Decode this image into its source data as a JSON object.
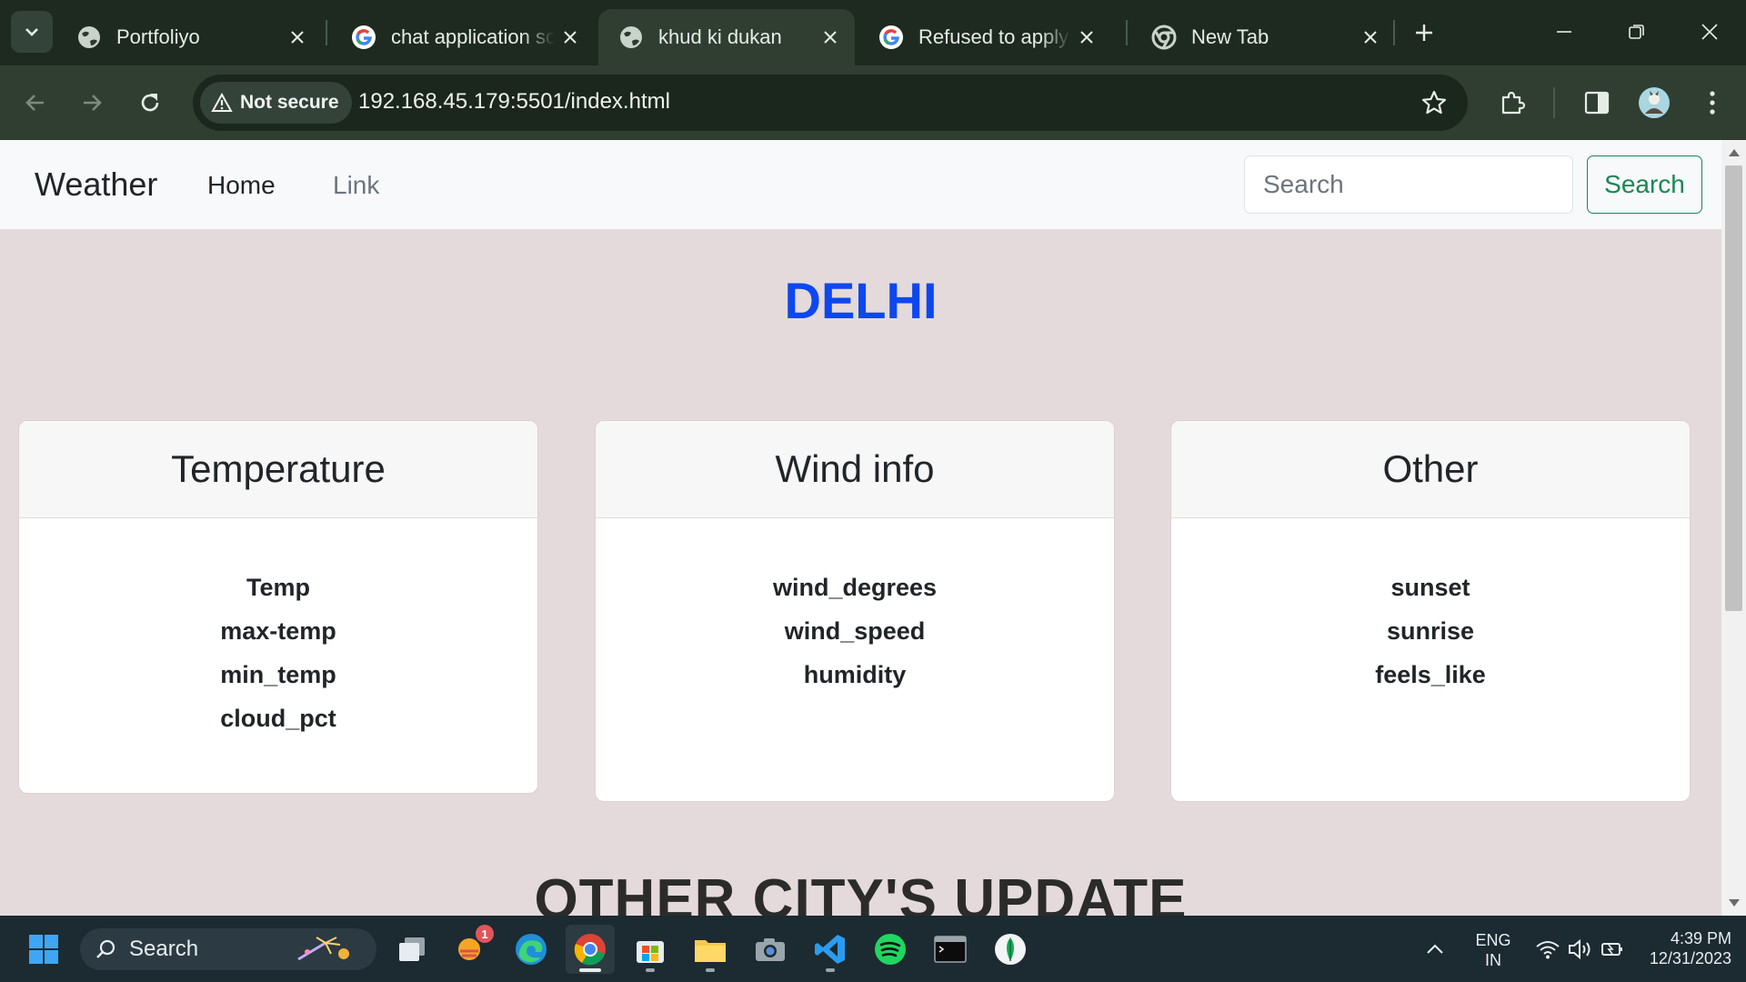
{
  "browser": {
    "tabs": [
      {
        "title": "Portfoliyo",
        "favicon": "globe-icon",
        "active": false
      },
      {
        "title": "chat application source",
        "favicon": "google-icon",
        "active": false
      },
      {
        "title": "khud ki dukan",
        "favicon": "globe-icon",
        "active": true
      },
      {
        "title": "Refused to apply style",
        "favicon": "google-icon",
        "active": false
      },
      {
        "title": "New Tab",
        "favicon": "chrome-icon",
        "active": false
      }
    ],
    "security_label": "Not secure",
    "url": "192.168.45.179:5501/index.html"
  },
  "page": {
    "brand": "Weather",
    "nav_links": [
      "Home",
      "Link"
    ],
    "search_placeholder": "Search",
    "search_button": "Search",
    "city": "DELHI",
    "cards": [
      {
        "title": "Temperature",
        "rows": [
          "Temp",
          "max-temp",
          "min_temp",
          "cloud_pct"
        ]
      },
      {
        "title": "Wind info",
        "rows": [
          "wind_degrees",
          "wind_speed",
          "humidity"
        ]
      },
      {
        "title": "Other",
        "rows": [
          "sunset",
          "sunrise",
          "feels_like"
        ]
      }
    ],
    "other_heading": "OTHER CITY'S UPDATE"
  },
  "taskbar": {
    "search_label": "Search",
    "notification_badge": "1",
    "language": "ENG",
    "region": "IN",
    "time": "4:39 PM",
    "date": "12/31/2023"
  },
  "colors": {
    "city_blue": "#0d47f0",
    "success_green": "#198754",
    "page_bg": "#e4dadb"
  }
}
